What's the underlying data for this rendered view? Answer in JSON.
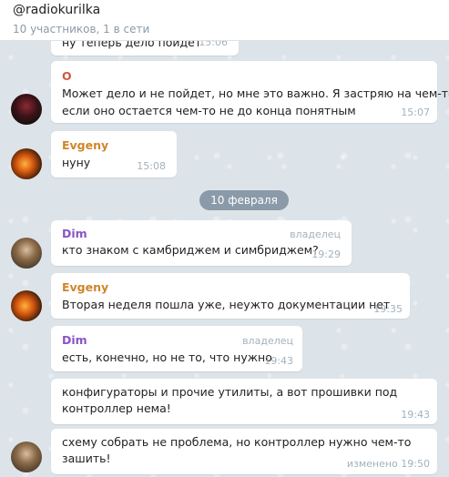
{
  "header": {
    "title": "@radiokurilka",
    "subtitle": "10 участников, 1 в сети"
  },
  "colors": {
    "name_o": "#d0563c",
    "name_evgeny": "#d0852a",
    "name_dim": "#8a54c6",
    "date_pill": "#6e8292"
  },
  "date_separator": "10 февраля",
  "messages": [
    {
      "text": "ну теперь дело пойдет",
      "time": "15:06"
    },
    {
      "author": "O",
      "line1": "Может дело и не пойдет, но мне это важно. Я застряю на чем-то,",
      "line2": "если оно остается чем-то не до конца понятным",
      "time": "15:07"
    },
    {
      "author": "Evgeny",
      "text": "нуну",
      "time": "15:08"
    },
    {
      "author": "Dim",
      "role": "владелец",
      "text": "кто знаком с камбриджем и симбриджем?",
      "time": "19:29"
    },
    {
      "author": "Evgeny",
      "text": "Вторая неделя пошла уже, неужто документации нет",
      "time": "19:35"
    },
    {
      "author": "Dim",
      "role": "владелец",
      "text": "есть, конечно, но не то, что нужно",
      "time": "19:43"
    },
    {
      "line1": "конфигураторы и прочие утилиты, а вот прошивки под",
      "line2": "контроллер нема!",
      "time": "19:43"
    },
    {
      "line1": "схему собрать не проблема, но контроллер нужно чем-то",
      "line2": "зашить!",
      "time": "изменено 19:50"
    }
  ]
}
